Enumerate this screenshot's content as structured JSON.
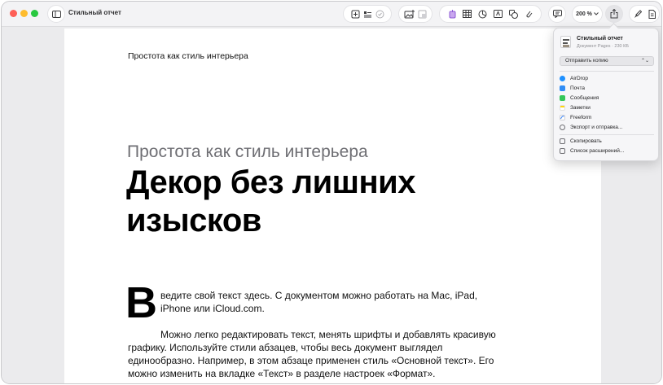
{
  "window": {
    "title": "Стильный отчет"
  },
  "toolbar": {
    "zoom": "200 %",
    "icons": [
      "sidebar-icon",
      "page-add-icon",
      "list-icon",
      "check-circle-icon",
      "image-add-icon",
      "resize-icon",
      "text-insert-icon",
      "table-icon",
      "chart-icon",
      "textbox-icon",
      "shape-icon",
      "media-icon",
      "comment-icon",
      "share-icon",
      "format-brush-icon",
      "document-icon"
    ]
  },
  "document": {
    "header": "Простота как стиль интерьера",
    "subtitle": "Простота как стиль интерьера",
    "title": "Декор без лишних изысков",
    "drop_cap": "В",
    "paragraph1": "ведите свой текст здесь. С документом можно работать на Mac, iPad, iPhone или iCloud.com.",
    "paragraph2": "Можно легко редактировать текст, менять шрифты и добавлять красивую графику. Используйте стили абзацев, чтобы весь документ выглядел единообразно. Например, в этом абзаце применен стиль «Основной текст». Его можно изменить на вкладке «Текст» в разделе настроек «Формат»."
  },
  "share_popover": {
    "doc_name": "Стильный отчет",
    "doc_info": "Документ Pages · 230 КБ",
    "send_copy": "Отправить копию",
    "items": [
      {
        "label": "AirDrop",
        "icon": "airdrop-icon",
        "color": "#1e90ff"
      },
      {
        "label": "Почта",
        "icon": "mail-icon",
        "color": "#2f8cf5"
      },
      {
        "label": "Сообщения",
        "icon": "messages-icon",
        "color": "#34c759"
      },
      {
        "label": "Заметки",
        "icon": "notes-icon",
        "color": "#ffd60a"
      },
      {
        "label": "Freeform",
        "icon": "freeform-icon",
        "color": "#2d7cf6"
      },
      {
        "label": "Экспорт и отправка...",
        "icon": "export-icon",
        "color": "#6e6e73"
      }
    ],
    "actions": [
      {
        "label": "Скопировать",
        "icon": "copy-icon"
      },
      {
        "label": "Список расширений...",
        "icon": "extensions-icon"
      }
    ]
  }
}
